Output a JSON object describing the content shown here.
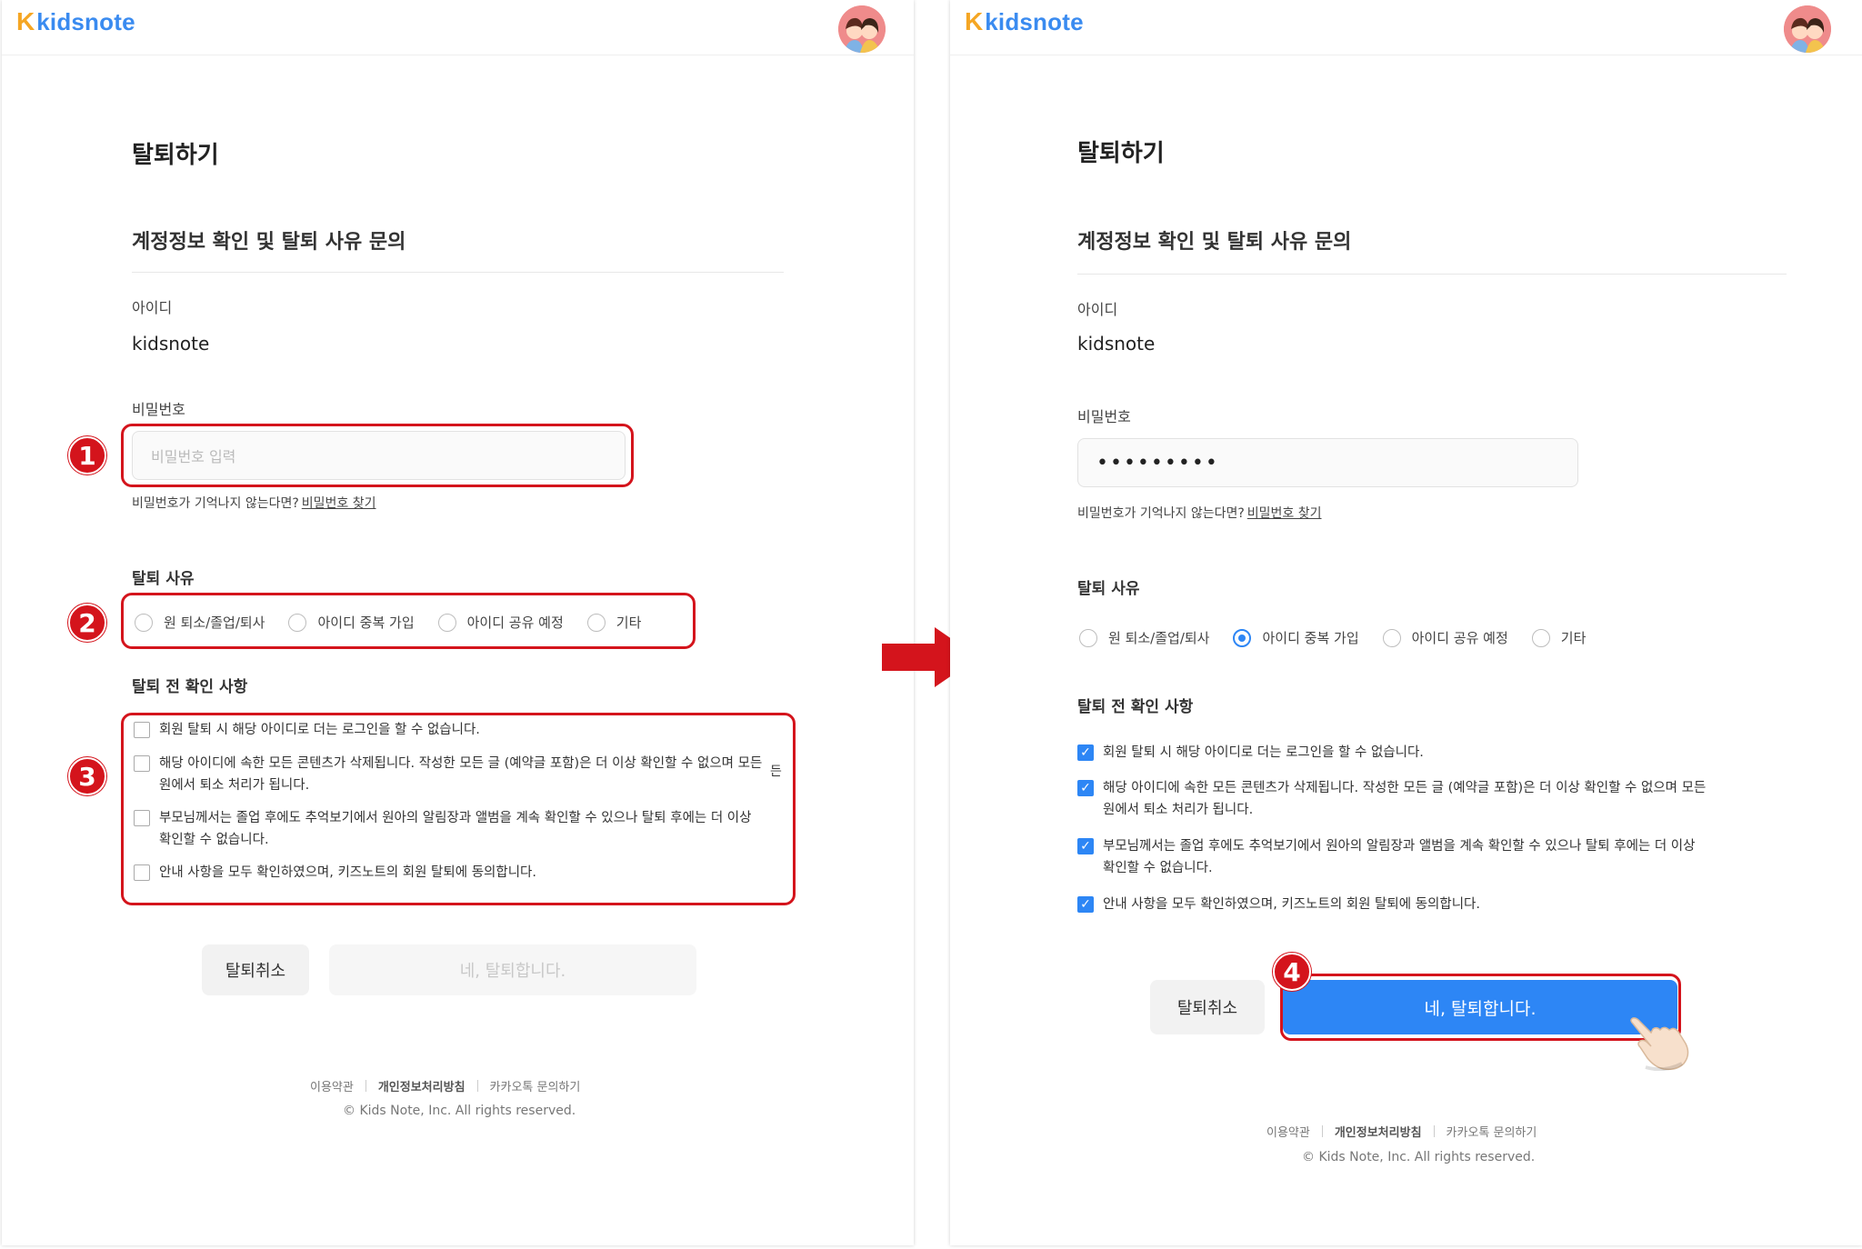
{
  "brand": {
    "logo_mark": "K",
    "logo_text": "kidsnote"
  },
  "page": {
    "title": "탈퇴하기",
    "section_title": "계정정보 확인 및 탈퇴 사유 문의",
    "id_label": "아이디",
    "id_value": "kidsnote",
    "password_label": "비밀번호",
    "password_placeholder": "비밀번호 입력",
    "password_filled": "•••••••••",
    "hint_text": "비밀번호가 기억나지 않는다면?",
    "hint_link": "비밀번호 찾기",
    "reason_label": "탈퇴 사유",
    "reasons": [
      "원 퇴소/졸업/퇴사",
      "아이디 중복 가입",
      "아이디 공유 예정",
      "기타"
    ],
    "selected_reason_after": "아이디 중복 가입",
    "confirm_label": "탈퇴 전 확인 사항",
    "checks": [
      [
        "회원 탈퇴 시 해당 아이디로 더는 로그인을 할 수 없습니다."
      ],
      [
        "해당 아이디에 속한 모든 콘텐츠가 삭제됩니다. 작성한 모든 글 (예약글 포함)은 더 이상 확인할 수 없으며 모든",
        "원에서 퇴소 처리가 됩니다."
      ],
      [
        "부모님께서는 졸업 후에도 추억보기에서 원아의 알림장과 앨범을 계속 확인할 수 있으나 탈퇴 후에는 더 이상",
        "확인할 수 없습니다."
      ],
      [
        "안내 사항을 모두 확인하였으며, 키즈노트의 회원 탈퇴에 동의합니다."
      ]
    ],
    "stray_char": "든",
    "cancel_button": "탈퇴취소",
    "confirm_button": "네, 탈퇴합니다."
  },
  "footer": {
    "links": [
      "이용약관",
      "개인정보처리방침",
      "카카오톡 문의하기"
    ],
    "copyright": "© Kids Note, Inc. All rights reserved."
  },
  "annotations": {
    "badges": [
      "1",
      "2",
      "3",
      "4"
    ],
    "highlight_color": "#d4141c"
  },
  "colors": {
    "primary": "#2d86f5",
    "logo_k": "#f5a623",
    "logo_text": "#3a8bf0"
  },
  "icons": [
    "kidsnote-logo-icon",
    "avatar-icon",
    "right-arrow-icon",
    "pointing-hand-icon",
    "checkmark-icon"
  ]
}
